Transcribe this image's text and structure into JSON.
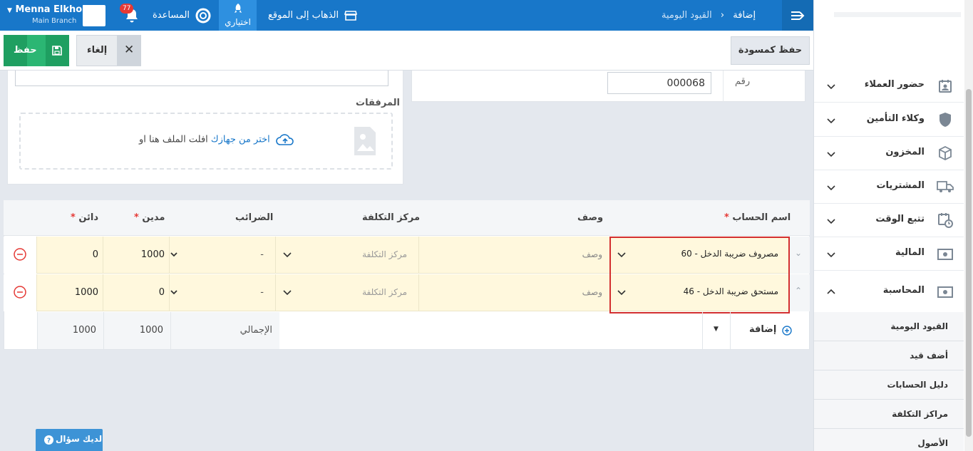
{
  "topbar": {
    "user_name": "Menna Elkholy",
    "branch": "Main Branch",
    "notification_count": "77",
    "help_label": "المساعدة",
    "optional_label": "اختياري",
    "goto_site_label": "الذهاب إلى الموقع",
    "breadcrumb_parent": "القيود اليومية",
    "breadcrumb_current": "إضافة"
  },
  "actions": {
    "save_label": "حفظ",
    "cancel_label": "إلغاء",
    "draft_label": "حفظ كمسودة"
  },
  "form": {
    "number_label": "رقم",
    "number_value": "000068",
    "attachments_label": "المرفقات",
    "drop_text": "افلت الملف هنا او",
    "choose_link": "اختر من جهازك"
  },
  "table": {
    "headers": {
      "account": "اسم الحساب",
      "description": "وصف",
      "cost_center": "مركز التكلفة",
      "taxes": "الضرائب",
      "debit": "مدين",
      "credit": "دائن",
      "required_mark": "*"
    },
    "rows": [
      {
        "account": "60 - مصروف ضريبة الدخل",
        "description": "وصف",
        "cost_center": "مركز التكلفة",
        "tax": "-",
        "debit": "1000",
        "credit": "0"
      },
      {
        "account": "46 - مستحق ضريبة الدخل",
        "description": "وصف",
        "cost_center": "مركز التكلفة",
        "tax": "-",
        "debit": "0",
        "credit": "1000"
      }
    ],
    "add_label": "إضافة",
    "total_label": "الإجمالي",
    "total_debit": "1000",
    "total_credit": "1000"
  },
  "sidebar": {
    "items": [
      {
        "label": "حضور العملاء",
        "icon": "calendar-user-icon"
      },
      {
        "label": "وكلاء التأمين",
        "icon": "shield-icon"
      },
      {
        "label": "المخزون",
        "icon": "box-icon"
      },
      {
        "label": "المشتريات",
        "icon": "truck-icon"
      },
      {
        "label": "تتبع الوقت",
        "icon": "calendar-clock-icon"
      },
      {
        "label": "المالية",
        "icon": "money-icon"
      },
      {
        "label": "المحاسبة",
        "icon": "money-icon"
      }
    ],
    "sub_items": [
      "القيود اليومية",
      "أضف قيد",
      "دليل الحسابات",
      "مراكز التكلفة",
      "الأصول"
    ]
  },
  "help_button_label": "لديك سؤال",
  "colors": {
    "primary": "#1877c9",
    "success": "#2bb673",
    "highlight": "#d32f2f",
    "row_bg": "#fff8dd"
  }
}
